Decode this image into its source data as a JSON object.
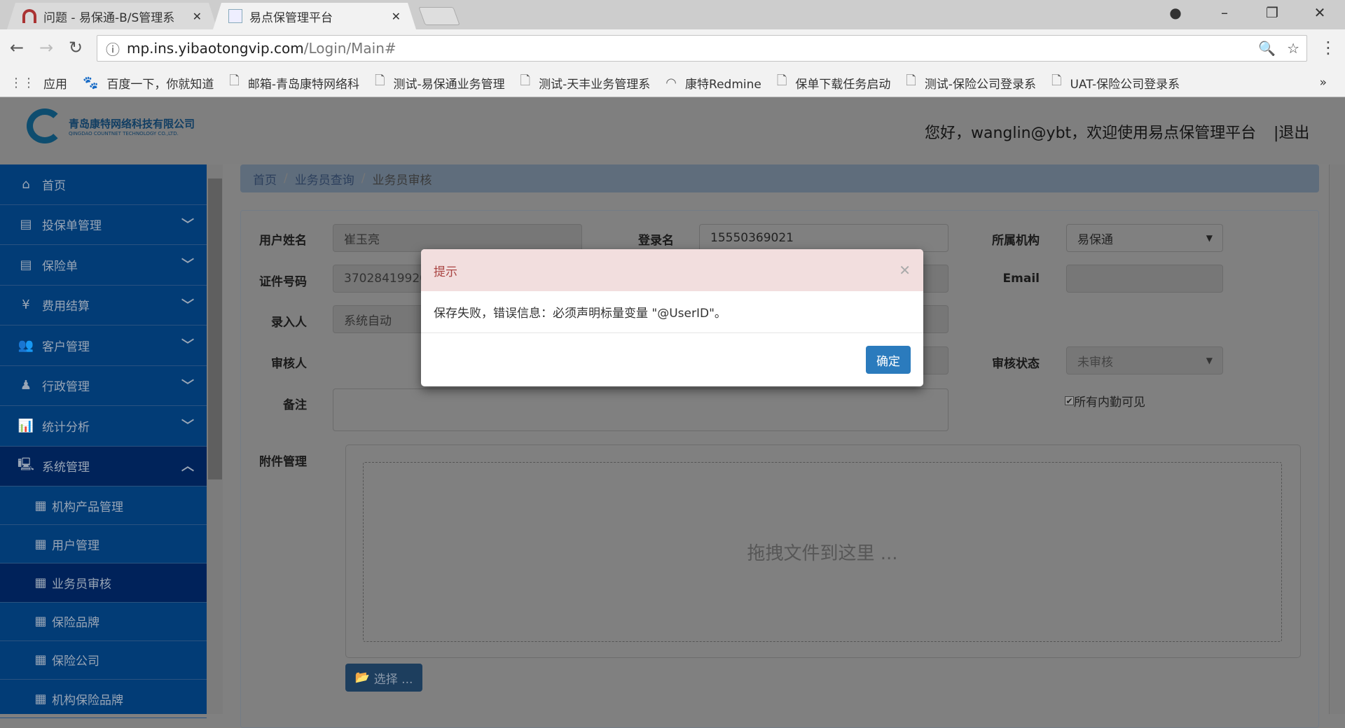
{
  "browser": {
    "tabs": [
      {
        "label": "问题 - 易保通-B/S管理系",
        "icon": "redmine-icon"
      },
      {
        "label": "易点保管理平台",
        "icon": "page-icon"
      }
    ],
    "url_host": "mp.ins.yibaotongvip.com",
    "url_path": "/Login/Main#",
    "bookmarks": [
      {
        "label": "应用",
        "icon": "apps-icon"
      },
      {
        "label": "百度一下，你就知道",
        "icon": "baidu-icon"
      },
      {
        "label": "邮箱-青岛康特网络科",
        "icon": "page-icon"
      },
      {
        "label": "测试-易保通业务管理",
        "icon": "page-icon"
      },
      {
        "label": "测试-天丰业务管理系",
        "icon": "page-icon"
      },
      {
        "label": "康特Redmine",
        "icon": "redmine-icon"
      },
      {
        "label": "保单下载任务启动",
        "icon": "page-icon"
      },
      {
        "label": "测试-保险公司登录系",
        "icon": "page-icon"
      },
      {
        "label": "UAT-保险公司登录系",
        "icon": "page-icon"
      }
    ],
    "more": "»"
  },
  "header": {
    "company_cn": "青岛康特网络科技有限公司",
    "company_en": "QINGDAO COUNTNET TECHNOLOGY CO.,LTD.",
    "greeting": "您好，wanglin@ybt，欢迎使用易点保管理平台",
    "logout": "|退出"
  },
  "sidebar": {
    "items": [
      {
        "label": "首页",
        "icon": "⌂"
      },
      {
        "label": "投保单管理",
        "icon": "▤"
      },
      {
        "label": "保险单",
        "icon": "▤"
      },
      {
        "label": "费用结算",
        "icon": "¥"
      },
      {
        "label": "客户管理",
        "icon": "👥"
      },
      {
        "label": "行政管理",
        "icon": "♟"
      },
      {
        "label": "统计分析",
        "icon": "📊"
      },
      {
        "label": "系统管理",
        "icon": "🖳"
      }
    ],
    "subitems": [
      "机构产品管理",
      "用户管理",
      "业务员审核",
      "保险品牌",
      "保险公司",
      "机构保险品牌"
    ]
  },
  "breadcrumb": [
    "首页",
    "业务员查询",
    "业务员审核"
  ],
  "form": {
    "username_label": "用户姓名",
    "username": "崔玉亮",
    "login_label": "登录名",
    "login": "15550369021",
    "org_label": "所属机构",
    "org": "易保通",
    "id_label": "证件号码",
    "id": "37028419920",
    "email_label": "Email",
    "email": "",
    "entry_label": "录入人",
    "entry": "系统自动",
    "reviewer_label": "审核人",
    "status_label": "审核状态",
    "status": "未审核",
    "remark_label": "备注",
    "visible_label": "所有内勤可见",
    "visible_checked": true,
    "attach_label": "附件管理",
    "drop_text": "拖拽文件到这里 ...",
    "choose": "选择 ..."
  },
  "modal": {
    "title": "提示",
    "message": "保存失败，错误信息：必须声明标量变量 \"@UserID\"。",
    "ok": "确定"
  }
}
